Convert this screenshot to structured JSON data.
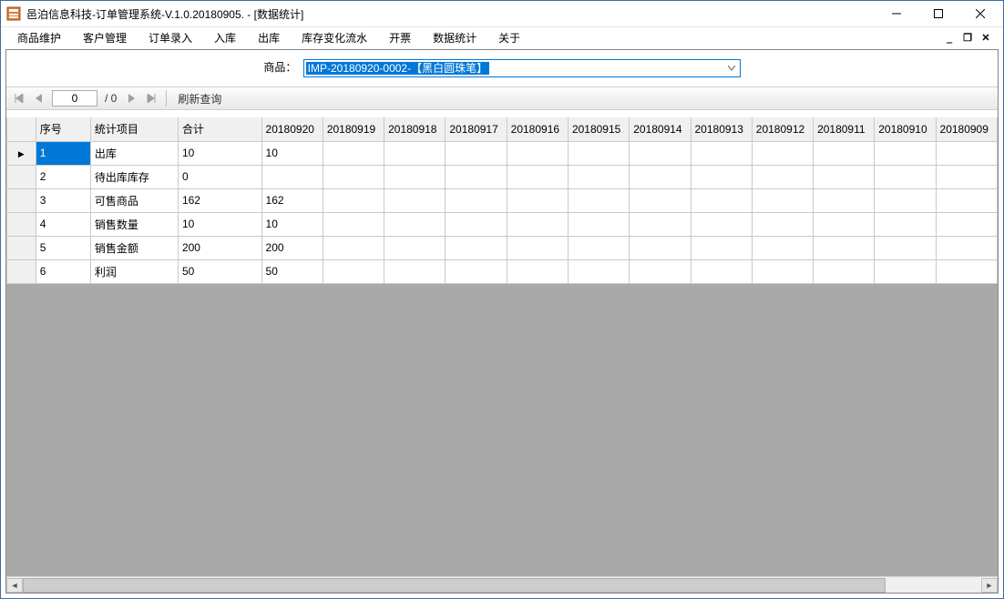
{
  "window": {
    "title": "邑泊信息科技-订单管理系统-V.1.0.20180905. - [数据统计]"
  },
  "menu": {
    "items": [
      "商品维护",
      "客户管理",
      "订单录入",
      "入库",
      "出库",
      "库存变化流水",
      "开票",
      "数据统计",
      "关于"
    ]
  },
  "filter": {
    "label": "商品：",
    "selected": "IMP-20180920-0002-【黑白圆珠笔】"
  },
  "navigator": {
    "position": "0",
    "total_text": "/ 0",
    "refresh_label": "刷新查询"
  },
  "grid": {
    "row_header_blank": "",
    "columns": [
      "序号",
      "统计项目",
      "合计",
      "20180920",
      "20180919",
      "20180918",
      "20180917",
      "20180916",
      "20180915",
      "20180914",
      "20180913",
      "20180912",
      "20180911",
      "20180910",
      "20180909"
    ],
    "rows": [
      {
        "seq": "1",
        "item": "出库",
        "total": "10",
        "d0": "10"
      },
      {
        "seq": "2",
        "item": "待出库库存",
        "total": "0",
        "d0": ""
      },
      {
        "seq": "3",
        "item": "可售商品",
        "total": "162",
        "d0": "162"
      },
      {
        "seq": "4",
        "item": "销售数量",
        "total": "10",
        "d0": "10"
      },
      {
        "seq": "5",
        "item": "销售金额",
        "total": "200",
        "d0": "200"
      },
      {
        "seq": "6",
        "item": "利润",
        "total": "50",
        "d0": "50"
      }
    ]
  }
}
